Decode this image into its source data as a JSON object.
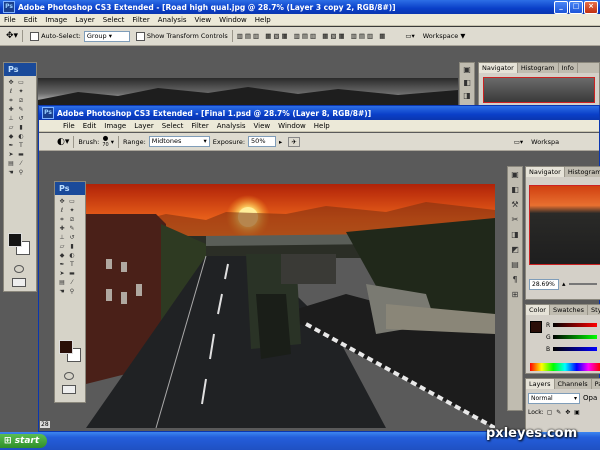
{
  "window_back": {
    "title": "Adobe Photoshop CS3 Extended - [Road high qual.jpg @ 28.7% (Layer 3 copy 2, RGB/8#)]",
    "menu": [
      "File",
      "Edit",
      "Image",
      "Layer",
      "Select",
      "Filter",
      "Analysis",
      "View",
      "Window",
      "Help"
    ],
    "options": {
      "auto_select_label": "Auto-Select:",
      "auto_select_value": "Group",
      "transform_label": "Show Transform Controls",
      "workspace_label": "Workspace ▼"
    },
    "toolbox_logo": "Ps",
    "panels": {
      "tabs": [
        "Navigator",
        "Histogram",
        "Info"
      ]
    }
  },
  "window_front": {
    "title": "Adobe Photoshop CS3 Extended - [Final 1.psd @ 28.7% (Layer 8, RGB/8#)]",
    "menu": [
      "File",
      "Edit",
      "Image",
      "Layer",
      "Select",
      "Filter",
      "Analysis",
      "View",
      "Window",
      "Help"
    ],
    "options": {
      "brush_label": "Brush:",
      "brush_size": "70",
      "range_label": "Range:",
      "range_value": "Midtones",
      "exposure_label": "Exposure:",
      "exposure_value": "50%",
      "workspace_label": "Workspa"
    },
    "toolbox_logo": "Ps",
    "navigator": {
      "tabs": [
        "Navigator",
        "Histogram"
      ],
      "zoom": "28.69%"
    },
    "color_panel": {
      "tabs": [
        "Color",
        "Swatches",
        "Sty"
      ],
      "channels": [
        "R",
        "G",
        "B"
      ]
    },
    "layers_panel": {
      "tabs": [
        "Layers",
        "Channels",
        "Pat"
      ],
      "blend_mode": "Normal",
      "opacity_label": "Opa",
      "lock_label": "Lock:"
    }
  },
  "taskbar": {
    "start_label": "start",
    "side_number": "28"
  },
  "watermark": "pxleyes.com",
  "colors": {
    "xp_blue": "#0a3fc8",
    "sky_orange": "#e8601a",
    "sun": "#ffe070"
  }
}
